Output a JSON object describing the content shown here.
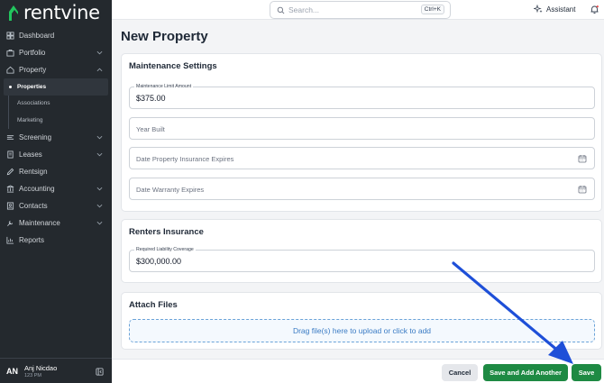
{
  "app": {
    "brand": "rentvine",
    "brand_color": "#22c55e"
  },
  "sidebar": {
    "items": [
      {
        "label": "Dashboard",
        "icon": "dashboard-icon"
      },
      {
        "label": "Portfolio",
        "icon": "portfolio-icon",
        "expandable": true
      },
      {
        "label": "Property",
        "icon": "property-icon",
        "expanded": true
      },
      {
        "label": "Screening",
        "icon": "screening-icon",
        "expandable": true
      },
      {
        "label": "Leases",
        "icon": "leases-icon",
        "expandable": true
      },
      {
        "label": "Rentsign",
        "icon": "rentsign-icon"
      },
      {
        "label": "Accounting",
        "icon": "accounting-icon",
        "expandable": true
      },
      {
        "label": "Contacts",
        "icon": "contacts-icon",
        "expandable": true
      },
      {
        "label": "Maintenance",
        "icon": "maintenance-icon",
        "expandable": true
      },
      {
        "label": "Reports",
        "icon": "reports-icon"
      }
    ],
    "property_sub": [
      "Properties",
      "Associations",
      "Marketing"
    ],
    "active_sub": "Properties",
    "user": {
      "initials": "AN",
      "name": "Anj Nicdao",
      "subtitle": "123 PM"
    }
  },
  "topbar": {
    "search_placeholder": "Search...",
    "search_shortcut": "Ctrl+K",
    "assistant_label": "Assistant"
  },
  "page": {
    "title": "New Property"
  },
  "maintenance": {
    "title": "Maintenance Settings",
    "limit_label": "Maintenance Limit Amount",
    "limit_value": "$375.00",
    "year_built_placeholder": "Year Built",
    "insurance_expires_placeholder": "Date Property Insurance Expires",
    "warranty_expires_placeholder": "Date Warranty Expires"
  },
  "renters": {
    "title": "Renters Insurance",
    "coverage_label": "Required Liability Coverage",
    "coverage_value": "$300,000.00"
  },
  "attach": {
    "title": "Attach Files",
    "dropzone_text": "Drag file(s) here to upload or click to add"
  },
  "footer": {
    "cancel_label": "Cancel",
    "save_another_label": "Save and Add Another",
    "save_label": "Save"
  },
  "colors": {
    "sidebar_bg": "#24292e",
    "primary_green": "#1e8a43",
    "annotation_arrow": "#1e4fd8"
  }
}
